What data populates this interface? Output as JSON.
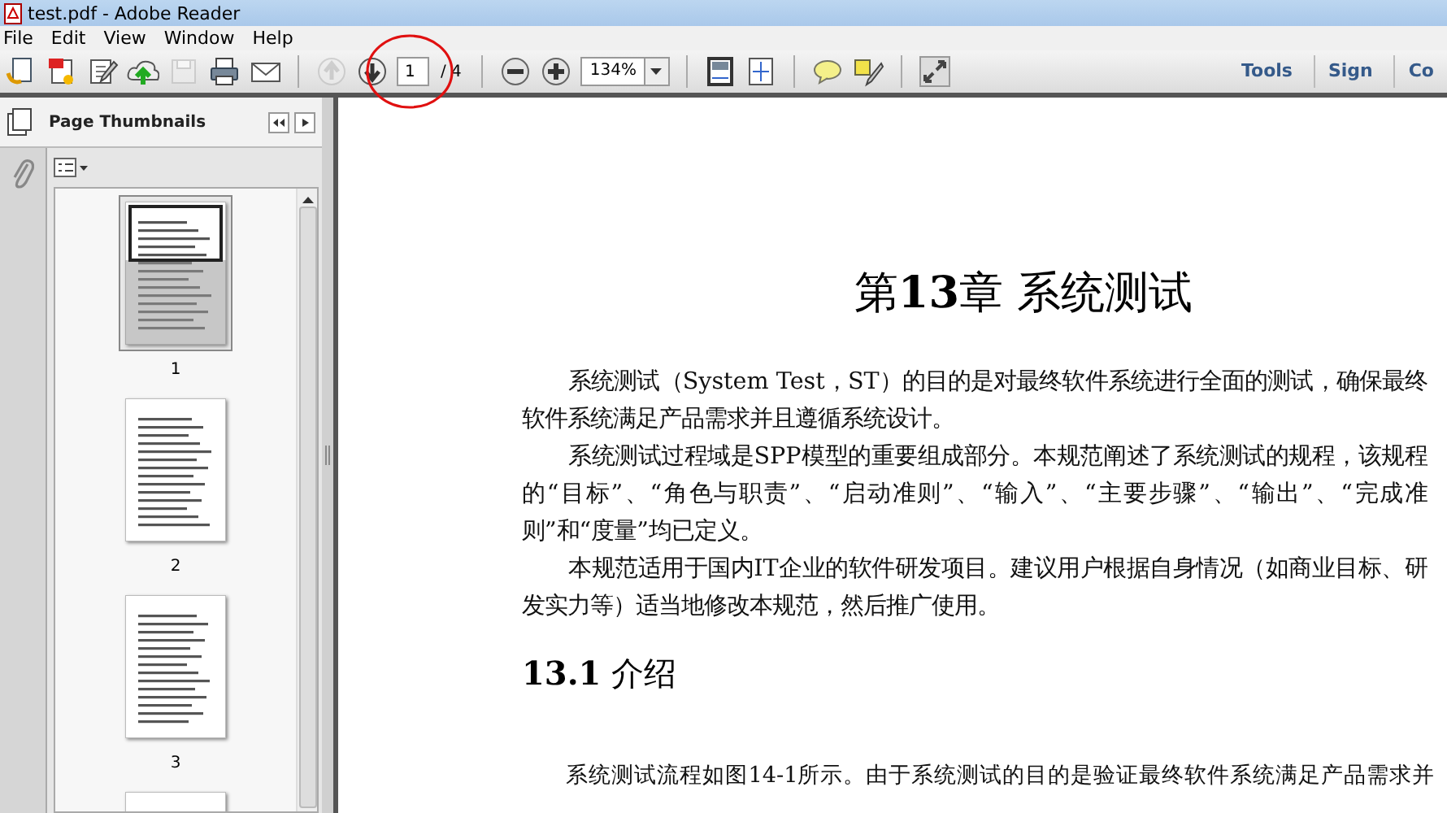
{
  "window": {
    "title": "test.pdf - Adobe Reader"
  },
  "menu": [
    "File",
    "Edit",
    "View",
    "Window",
    "Help"
  ],
  "toolbar": {
    "buttons": [
      {
        "disabled": false
      },
      {
        "disabled": false
      },
      {
        "disabled": false
      },
      {
        "disabled": false
      },
      {
        "disabled": true
      },
      {
        "disabled": false
      },
      {
        "disabled": false
      },
      {
        "disabled": true
      },
      {
        "disabled": false
      }
    ],
    "page_number": "1",
    "page_total": "/ 4",
    "zoom": "134%",
    "right_links": [
      "Tools",
      "Sign",
      "Co"
    ]
  },
  "sidebar": {
    "title": "Page Thumbnails",
    "thumbnails": [
      {
        "label": "1",
        "selected": true
      },
      {
        "label": "2",
        "selected": false
      },
      {
        "label": "3",
        "selected": false
      },
      {
        "selected": false
      }
    ]
  },
  "document": {
    "title": "第**13**章 系统测试",
    "paragraphs": [
      "系统测试（System Test，ST）的目的是对最终软件系统进行全面的测试，确保最终软件系统满足产品需求并且遵循系统设计。",
      "系统测试过程域是SPP模型的重要组成部分。本规范阐述了系统测试的规程，该规程的“目标”、“角色与职责”、“启动准则”、“输入”、“主要步骤”、“输出”、“完成准则”和“度量”均已定义。",
      "本规范适用于国内IT企业的软件研发项目。建议用户根据自身情况（如商业目标、研发实力等）适当地修改本规范，然后推广使用。"
    ],
    "section_heading": "**13.1** 介绍",
    "section_text": "系统测试流程如图14-1所示。由于系统测试的目的是验证最终软件系统满足产品需求并"
  }
}
